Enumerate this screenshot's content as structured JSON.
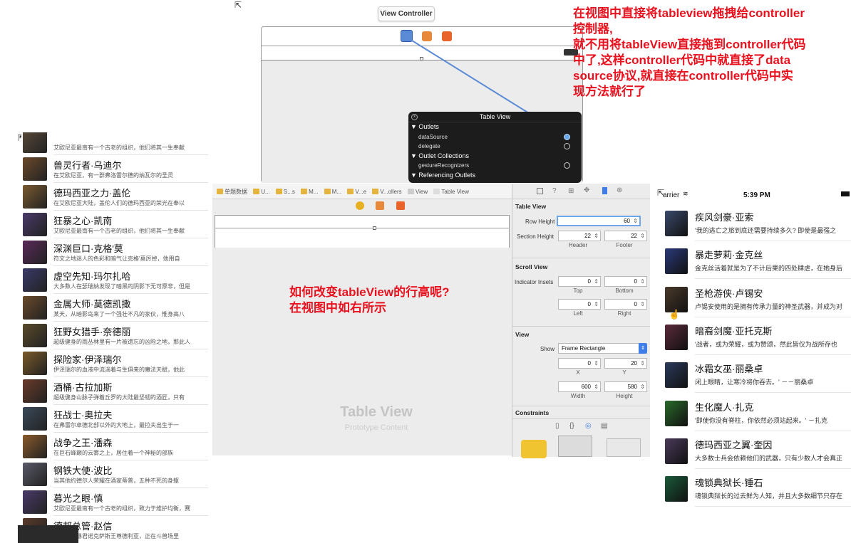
{
  "storyboard": {
    "scene_title": "View Controller",
    "hud": {
      "title": "Table View",
      "close": "x",
      "sections": [
        {
          "label": "▼ Outlets",
          "items": [
            "dataSource",
            "delegate"
          ]
        },
        {
          "label": "▼ Outlet Collections",
          "items": [
            "gestureRecognizers"
          ]
        },
        {
          "label": "▼ Referencing Outlets",
          "items": []
        }
      ]
    }
  },
  "annotation_top": [
    "在视图中直接将tableview拖拽给controller",
    "控制器,",
    "就不用将tableView直接拖到controller代码",
    "中了,这样controller代码中就直接了data",
    "source协议,就直接在controller代码中实",
    "现方法就行了"
  ],
  "annotation_mid": [
    "如何改变tableView的行高呢?",
    "在视图中如右所示"
  ],
  "left_list": [
    {
      "name": "",
      "desc": "艾欧尼亚最南有一个古老的组织，他们将其一生奉献",
      "color": "#5a4a3a"
    },
    {
      "name": "兽灵行者·乌迪尔",
      "desc": "在艾欧尼亚，有一群弗洛雷尔德的纳瓦尔的圣灵",
      "color": "#6b4a2a"
    },
    {
      "name": "德玛西亚之力·盖伦",
      "desc": "在艾欧尼亚大陆，盖伦人们的德玛西亚的荣光在奉以",
      "color": "#7a5a30"
    },
    {
      "name": "狂暴之心·凯南",
      "desc": "艾欧尼亚最南有一个古老的组织，他们将其一生奉献",
      "color": "#4a3a6a"
    },
    {
      "name": "深渊巨口·克格'莫",
      "desc": "符文之地迷人的色彩和暗气让克格'莫厉掉，他用自",
      "color": "#5a2a5a"
    },
    {
      "name": "虚空先知·玛尔扎哈",
      "desc": "大多数人在瑟瑞纳发现了暗黑的阴影下无可厚非，但是",
      "color": "#3a3a6a"
    },
    {
      "name": "金属大师·莫德凯撒",
      "desc": "某天，从暗影岛来了一个强壮不凡的家伙，惟身高八",
      "color": "#6a4a2a"
    },
    {
      "name": "狂野女猎手·奈德丽",
      "desc": "超级健身的雨丛林里有一片被遗忘的凶险之地，那此人",
      "color": "#5a4a2a"
    },
    {
      "name": "探险家·伊泽瑞尔",
      "desc": "伊泽瑞尔的血液中流淌着与生俱来的魔法天赋，他此",
      "color": "#7a5a2a"
    },
    {
      "name": "酒桶·古拉加斯",
      "desc": "超级健身山脉子弹着丘罗的大陆最坚韧的酒匠，只有",
      "color": "#6a3a2a"
    },
    {
      "name": "狂战士·奥拉夫",
      "desc": "在弗雷尔卓德北部以外的大地上，最拉夫出生于一",
      "color": "#3a4a5a"
    },
    {
      "name": "战争之王·潘森",
      "desc": "在巨石峰巅的云雾之上，居住着一个神秘的部族",
      "color": "#8a5a2a"
    },
    {
      "name": "钢铁大使·波比",
      "desc": "当其他约德尔人荣耀在酒家蒂普，五种不死的身躯",
      "color": "#5a5a6a"
    },
    {
      "name": "暮光之眼·慎",
      "desc": "艾欧尼亚最南有一个古老的组织，致力于维护均衡，赛",
      "color": "#4a3a6a"
    },
    {
      "name": "德邦总管·赵信",
      "desc": "德邦德的暴君诺克萨斯王尊德利亚，正在斗兽场里",
      "color": "#5a3a2a"
    }
  ],
  "xcode": {
    "jumpbar": [
      "单题数据",
      "U...",
      "S...s",
      "M...",
      "M...",
      "V...e",
      "V...ollers",
      "View",
      "Table View"
    ],
    "placeholder_title": "Table View",
    "placeholder_sub": "Prototype Content",
    "inspector": {
      "table_view_section": "Table View",
      "row_height_label": "Row Height",
      "row_height_value": "60",
      "section_height_label": "Section Height",
      "header_value": "22",
      "footer_value": "22",
      "header_label": "Header",
      "footer_label": "Footer",
      "scroll_view_section": "Scroll View",
      "indicator_insets_label": "Indicator Insets",
      "inset_top": "0",
      "inset_bottom": "0",
      "inset_left": "0",
      "inset_right": "0",
      "top_label": "Top",
      "bottom_label": "Bottom",
      "left_label": "Left",
      "right_label": "Right",
      "view_section": "View",
      "show_label": "Show",
      "show_value": "Frame Rectangle",
      "x_value": "0",
      "y_value": "20",
      "x_label": "X",
      "y_label": "Y",
      "width_value": "600",
      "height_value": "580",
      "width_label": "Width",
      "height_label": "Height",
      "constraints_section": "Constraints"
    }
  },
  "right_phone": {
    "carrier": "arrier",
    "time": "5:39 PM",
    "rows": [
      {
        "name": "疾风剑豪·亚索",
        "desc": "'我的逃亡之旅到底还需要持续多久? 即使是最强之",
        "color": "#3a4a6a"
      },
      {
        "name": "暴走萝莉·金克丝",
        "desc": "金克丝活着就是为了不计后果的四处肆虐，在她身后",
        "color": "#2a3a7a"
      },
      {
        "name": "圣枪游侠·卢锡安",
        "desc": "卢锡安使用的是拥有传承力量的神圣武器，并成为对",
        "color": "#4a3a2a"
      },
      {
        "name": "暗裔剑魔·亚托克斯",
        "desc": "'战者，或为荣耀，或为赞颂，然此皆仅为战所存也",
        "color": "#5a2a3a"
      },
      {
        "name": "冰霜女巫·丽桑卓",
        "desc": "闭上眼睛，让寒冷将你吞去。' －－丽桑卓",
        "color": "#2a3a5a"
      },
      {
        "name": "生化魔人·扎克",
        "desc": "'即使你没有脊柱，你依然必须站起来。' －扎克",
        "color": "#2a6a2a"
      },
      {
        "name": "德玛西亚之翼·奎因",
        "desc": "大多数士兵会依赖他们的武器，只有少数人才会真正",
        "color": "#4a3a5a"
      },
      {
        "name": "魂锁典狱长·锤石",
        "desc": "魂锁典狱长的过去鲜为人知，并且大多数细节只存在",
        "color": "#1a5a3a"
      }
    ]
  },
  "colors": {
    "accent": "#3f7ee8",
    "annotation": "#e8121f",
    "hud_bg": "#1c1c1c"
  }
}
